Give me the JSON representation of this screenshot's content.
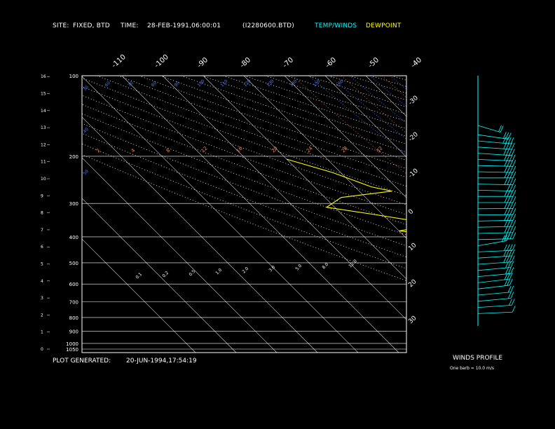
{
  "header": {
    "site_label": "SITE:",
    "site_value": "FIXED, BTD",
    "time_label": "TIME:",
    "time_value": "28-FEB-1991,06:00:01",
    "file_value": "(I2280600.BTD)",
    "legend_temp": "TEMP/WINDS",
    "legend_dewpoint": "DEWPOINT"
  },
  "footer": {
    "generated_label": "PLOT GENERATED:",
    "generated_value": "20-JUN-1994,17:54:19"
  },
  "winds_panel": {
    "title": "WINDS PROFILE",
    "note": "One barb = 10.0 m/s"
  },
  "colors": {
    "background": "#000000",
    "frame": "#ffffff",
    "temperature": "#00ffff",
    "dewpoint": "#ffff00",
    "dry_adiabat": "#ffffff",
    "moist_adiabat": "#4f7fff",
    "mixing_ratio": "#ff8040"
  },
  "chart_data": {
    "type": "line",
    "pressure_levels_mb": [
      100,
      200,
      300,
      400,
      500,
      600,
      700,
      800,
      900,
      1000,
      1050
    ],
    "height_ticks_km": [
      0,
      1,
      2,
      3,
      4,
      5,
      6,
      7,
      8,
      9,
      10,
      11,
      12,
      13,
      14,
      15,
      16
    ],
    "isotherm_labels_top": [
      "-110",
      "-100",
      "-90",
      "-80",
      "-70",
      "-60",
      "-50",
      "-40"
    ],
    "isotherm_labels_right": [
      "-30",
      "-20",
      "-10",
      "0",
      "10",
      "20",
      "30"
    ],
    "moist_adiabat_labels": [
      "30",
      "40",
      "50",
      "60",
      "70",
      "80",
      "90",
      "100",
      "110",
      "120",
      "130",
      "140",
      "150",
      "160"
    ],
    "mixing_ratio_labels": [
      "2",
      "4",
      "8",
      "12",
      "16",
      "20",
      "24",
      "28",
      "32"
    ],
    "inner_labels": [
      "0.1",
      "0.2",
      "0.5",
      "1.0",
      "2.0",
      "3.0",
      "5.0",
      "8.0",
      "12.0"
    ],
    "series": [
      {
        "name": "TEMP/WINDS",
        "points": [
          {
            "p": 200,
            "t": -58
          },
          {
            "p": 215,
            "t": -59
          },
          {
            "p": 240,
            "t": -56
          },
          {
            "p": 270,
            "t": -51
          },
          {
            "p": 300,
            "t": -48
          },
          {
            "p": 330,
            "t": -44
          },
          {
            "p": 360,
            "t": -40
          },
          {
            "p": 400,
            "t": -36
          },
          {
            "p": 450,
            "t": -30
          },
          {
            "p": 500,
            "t": -25
          },
          {
            "p": 560,
            "t": -19
          },
          {
            "p": 600,
            "t": -14
          },
          {
            "p": 650,
            "t": -9
          },
          {
            "p": 700,
            "t": -4
          },
          {
            "p": 750,
            "t": 1
          },
          {
            "p": 790,
            "t": 5
          },
          {
            "p": 800,
            "t": 9
          },
          {
            "p": 812,
            "t": 12
          },
          {
            "p": 820,
            "t": -8
          }
        ]
      },
      {
        "name": "DEWPOINT",
        "points": [
          {
            "p": 205,
            "t": -90
          },
          {
            "p": 230,
            "t": -82
          },
          {
            "p": 260,
            "t": -76
          },
          {
            "p": 270,
            "t": -72
          },
          {
            "p": 285,
            "t": -86
          },
          {
            "p": 310,
            "t": -92
          },
          {
            "p": 330,
            "t": -82
          },
          {
            "p": 360,
            "t": -69
          },
          {
            "p": 380,
            "t": -80
          },
          {
            "p": 400,
            "t": -68
          },
          {
            "p": 420,
            "t": -76
          },
          {
            "p": 440,
            "t": -67
          },
          {
            "p": 460,
            "t": -73
          },
          {
            "p": 480,
            "t": -63
          },
          {
            "p": 500,
            "t": -62
          },
          {
            "p": 520,
            "t": -57
          },
          {
            "p": 550,
            "t": -54
          },
          {
            "p": 580,
            "t": -48
          },
          {
            "p": 600,
            "t": -43
          },
          {
            "p": 650,
            "t": -36
          },
          {
            "p": 700,
            "t": -33
          },
          {
            "p": 780,
            "t": -31
          },
          {
            "p": 820,
            "t": -32
          }
        ]
      }
    ],
    "wind_barbs": [
      {
        "km": 0.8,
        "dir": 260,
        "speed": 10
      },
      {
        "km": 1.2,
        "dir": 255,
        "speed": 20
      },
      {
        "km": 1.6,
        "dir": 250,
        "speed": 20
      },
      {
        "km": 2.0,
        "dir": 250,
        "speed": 20
      },
      {
        "km": 2.4,
        "dir": 245,
        "speed": 30
      },
      {
        "km": 2.8,
        "dir": 245,
        "speed": 30
      },
      {
        "km": 3.2,
        "dir": 250,
        "speed": 30
      },
      {
        "km": 3.6,
        "dir": 250,
        "speed": 30
      },
      {
        "km": 4.0,
        "dir": 255,
        "speed": 40
      },
      {
        "km": 4.4,
        "dir": 255,
        "speed": 40
      },
      {
        "km": 4.8,
        "dir": 260,
        "speed": 40
      },
      {
        "km": 5.2,
        "dir": 235,
        "speed": 30
      },
      {
        "km": 5.6,
        "dir": 265,
        "speed": 40
      },
      {
        "km": 6.0,
        "dir": 265,
        "speed": 40
      },
      {
        "km": 6.4,
        "dir": 265,
        "speed": 40
      },
      {
        "km": 6.8,
        "dir": 265,
        "speed": 40
      },
      {
        "km": 7.2,
        "dir": 268,
        "speed": 40
      },
      {
        "km": 7.6,
        "dir": 268,
        "speed": 40
      },
      {
        "km": 8.0,
        "dir": 270,
        "speed": 40
      },
      {
        "km": 8.4,
        "dir": 270,
        "speed": 40
      },
      {
        "km": 8.8,
        "dir": 275,
        "speed": 30
      },
      {
        "km": 9.2,
        "dir": 275,
        "speed": 40
      },
      {
        "km": 9.6,
        "dir": 270,
        "speed": 40
      },
      {
        "km": 10.0,
        "dir": 275,
        "speed": 40
      },
      {
        "km": 10.4,
        "dir": 275,
        "speed": 40
      },
      {
        "km": 10.8,
        "dir": 280,
        "speed": 40
      },
      {
        "km": 11.2,
        "dir": 285,
        "speed": 40
      },
      {
        "km": 11.6,
        "dir": 285,
        "speed": 40
      },
      {
        "km": 12.0,
        "dir": 290,
        "speed": 40
      },
      {
        "km": 12.4,
        "dir": 300,
        "speed": 30
      },
      {
        "km": 13.0,
        "dir": 320,
        "speed": 20
      }
    ]
  }
}
